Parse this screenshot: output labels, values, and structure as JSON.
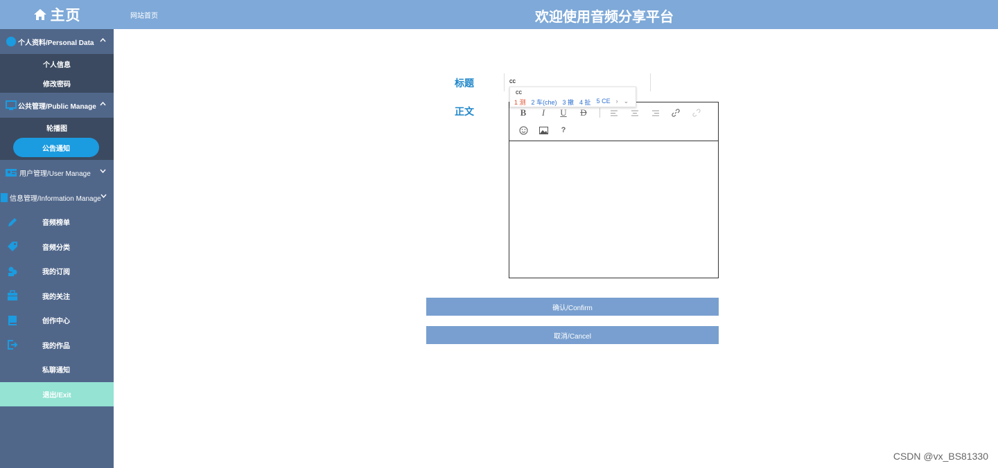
{
  "sidebar": {
    "brand": "主页",
    "groups": [
      {
        "label": "个人资料/Personal Data",
        "items": [
          "个人信息",
          "修改密码"
        ]
      },
      {
        "label": "公共管理/Public Manage",
        "items": [
          "轮播图",
          "公告通知"
        ],
        "active": "公告通知"
      },
      {
        "label": "用户管理/User Manage"
      },
      {
        "label": "信息管理/Information Manage"
      }
    ],
    "menu": [
      "音频榜单",
      "音频分类",
      "我的订阅",
      "我的关注",
      "创作中心",
      "我的作品",
      "私聊通知"
    ],
    "exit": "退出/Exit"
  },
  "header": {
    "breadcrumb": "网站首页",
    "title": "欢迎使用音频分享平台"
  },
  "form": {
    "title_label": "标题",
    "title_value": "cc",
    "content_label": "正文",
    "ime": {
      "composition": "cc",
      "candidates": [
        "1 测",
        "2 车(che)",
        "3 撤",
        "4 扯",
        "5 CE"
      ]
    },
    "editor_tools": [
      "bold-icon",
      "italic-icon",
      "underline-icon",
      "strikethrough-icon",
      "align-left-icon",
      "align-center-icon",
      "align-right-icon",
      "link-icon",
      "unlink-icon",
      "emoji-icon",
      "image-icon",
      "help-icon"
    ],
    "confirm": "确认/Confirm",
    "cancel": "取消/Cancel"
  },
  "watermark": "CSDN @vx_BS81330",
  "colors": {
    "sidebar": "#51678a",
    "submenu": "#3b4a60",
    "header": "#7ea9d8",
    "active": "#1b9be0",
    "exit": "#94e3d3",
    "button": "#789fcf",
    "label": "#1f86c9"
  }
}
